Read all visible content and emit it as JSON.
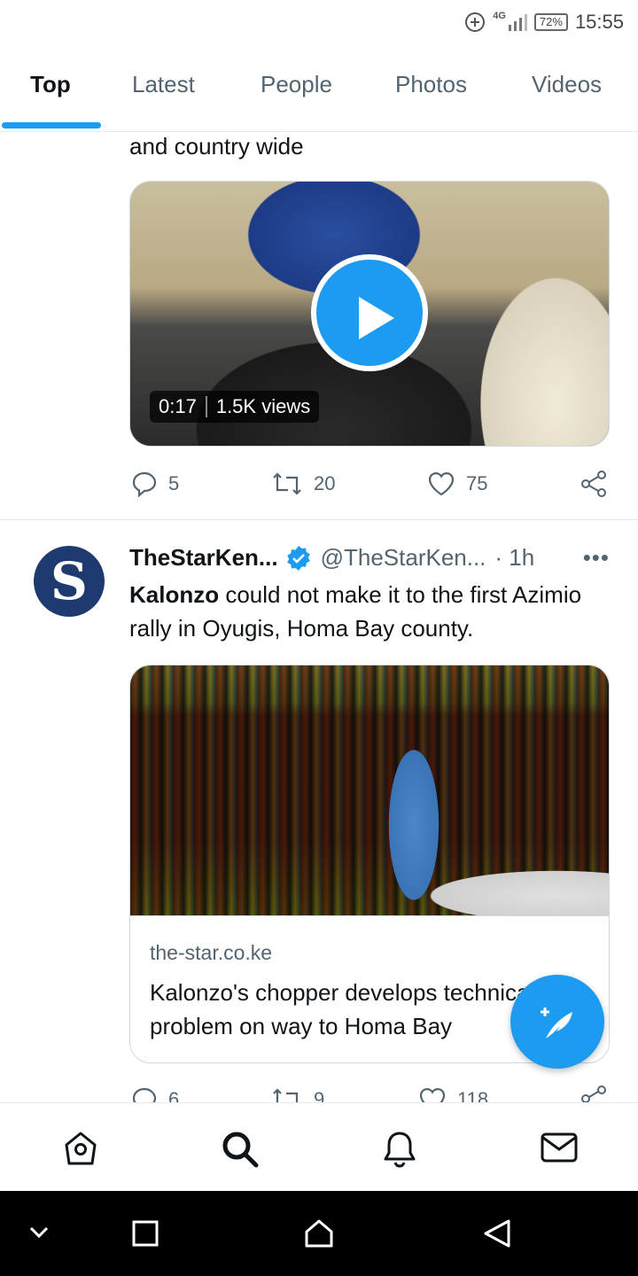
{
  "status_bar": {
    "network": "4G",
    "battery": "72%",
    "time": "15:55"
  },
  "tabs": [
    {
      "label": "Top",
      "active": true
    },
    {
      "label": "Latest",
      "active": false
    },
    {
      "label": "People",
      "active": false
    },
    {
      "label": "Photos",
      "active": false
    },
    {
      "label": "Videos",
      "active": false
    }
  ],
  "tweet1": {
    "text_tail": "and country wide",
    "video": {
      "duration": "0:17",
      "views": "1.5K views"
    },
    "stats": {
      "replies": "5",
      "retweets": "20",
      "likes": "75"
    }
  },
  "tweet2": {
    "name": "TheStarKen...",
    "handle": "@TheStarKen...",
    "time": "· 1h",
    "more": "•••",
    "text_bold": "Kalonzo",
    "text_rest": " could not make it to the first Azimio rally in Oyugis, Homa Bay county.",
    "avatar_letter": "S",
    "card": {
      "domain": "the-star.co.ke",
      "title": "Kalonzo's chopper develops technical problem on way to Homa Bay"
    },
    "stats": {
      "replies": "6",
      "retweets": "9",
      "likes": "118"
    }
  },
  "bottom_nav": [
    "home-icon",
    "search-icon",
    "notifications-icon",
    "messages-icon"
  ],
  "system_nav": [
    "hide-keyboard-icon",
    "recents-icon",
    "home-button-icon",
    "back-icon"
  ],
  "colors": {
    "accent": "#1d9bf0",
    "text": "#0f1419",
    "muted": "#536471",
    "border": "#cfd9de"
  }
}
